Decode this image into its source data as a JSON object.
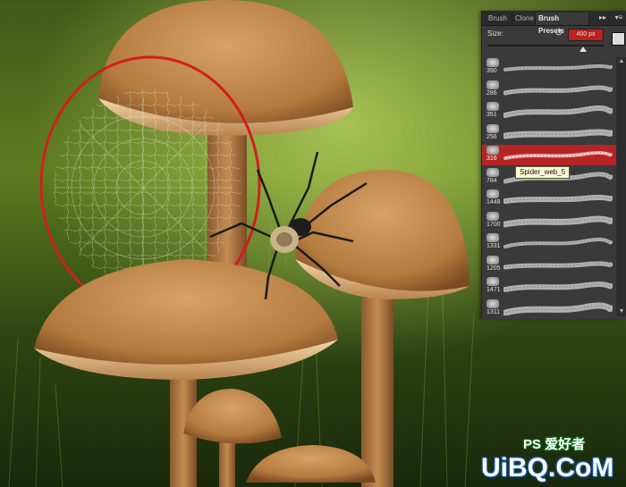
{
  "panel": {
    "tabs": [
      "Brush",
      "Clone",
      "Brush Presets"
    ],
    "menu_icons": [
      "expand-arrows-icon",
      "panel-menu-icon"
    ],
    "size_label": "Size:",
    "size_value": "400 px",
    "size_fraction": 0.82,
    "presets": [
      {
        "num": "390"
      },
      {
        "num": "286"
      },
      {
        "num": "351"
      },
      {
        "num": "256"
      },
      {
        "num": "316",
        "selected": true
      },
      {
        "num": "784"
      },
      {
        "num": "1448"
      },
      {
        "num": "1700"
      },
      {
        "num": "1331"
      },
      {
        "num": "1205"
      },
      {
        "num": "1471"
      },
      {
        "num": "1311"
      }
    ],
    "selected_color": "#b52525"
  },
  "tooltip": "Spider_web_5",
  "watermark": {
    "main": "UiBQ.CoM",
    "sub": "PS 爱好者"
  }
}
